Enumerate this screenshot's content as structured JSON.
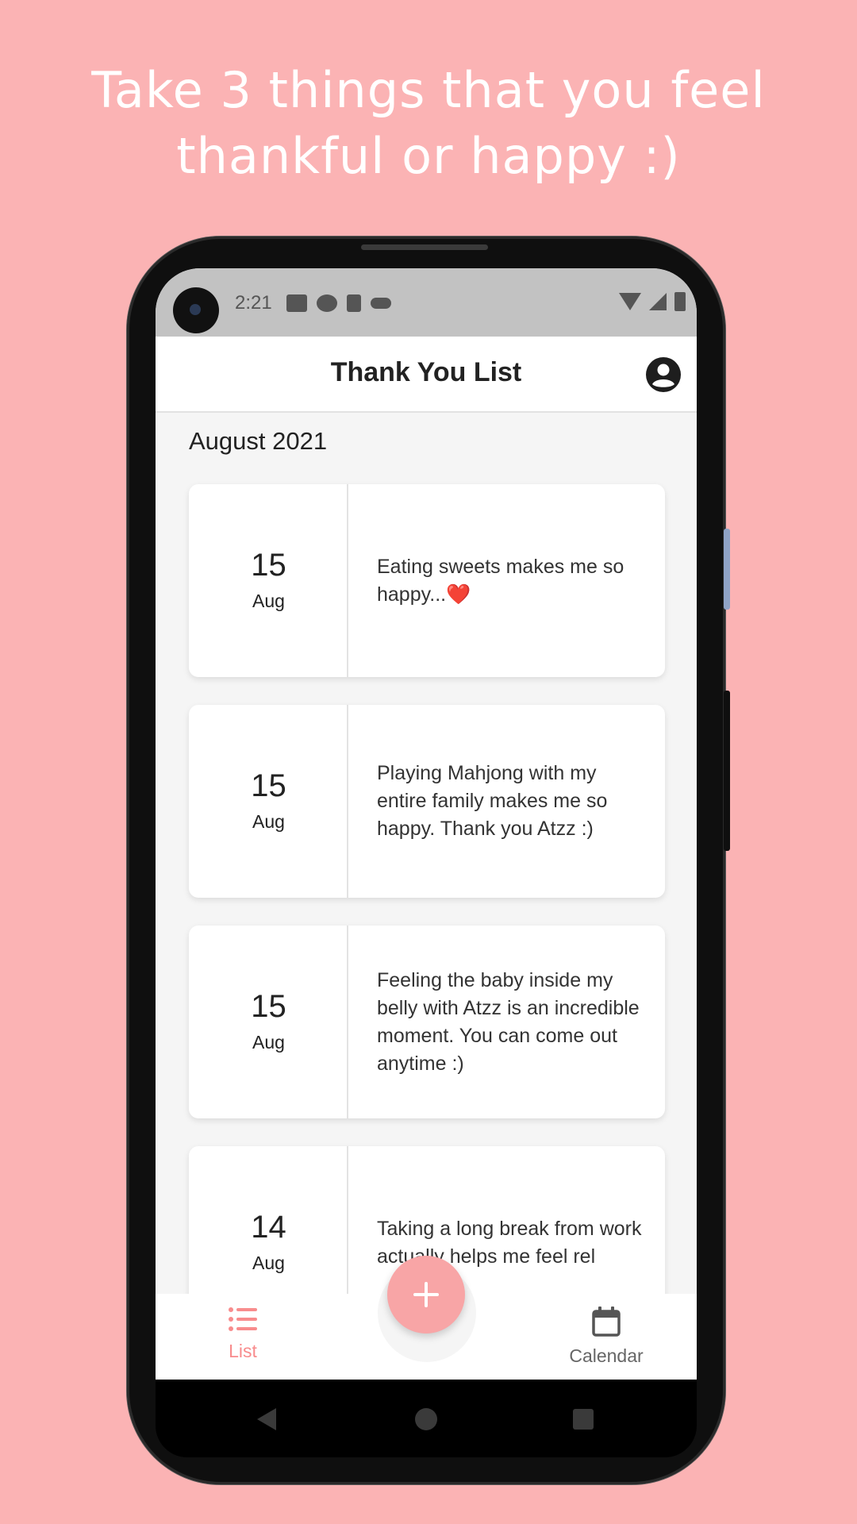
{
  "headline": {
    "line1": "Take 3 things that you feel",
    "line2": "thankful or happy :)"
  },
  "status_bar": {
    "time": "2:21"
  },
  "app_bar": {
    "title": "Thank You List"
  },
  "month_header": "August 2021",
  "entries": [
    {
      "day": "15",
      "month": "Aug",
      "text": "Eating sweets makes me so happy...❤️"
    },
    {
      "day": "15",
      "month": "Aug",
      "text": "Playing Mahjong with my entire family makes me so happy. Thank you Atzz :)"
    },
    {
      "day": "15",
      "month": "Aug",
      "text": "Feeling the baby inside my belly with Atzz is an incredible moment. You can come out anytime :)"
    },
    {
      "day": "14",
      "month": "Aug",
      "text": "Taking a long break from work actually helps me feel rel"
    }
  ],
  "bottom_nav": {
    "list_label": "List",
    "calendar_label": "Calendar"
  },
  "colors": {
    "background": "#FBB3B4",
    "accent": "#F88C8D",
    "fab": "#F8A5A6"
  }
}
